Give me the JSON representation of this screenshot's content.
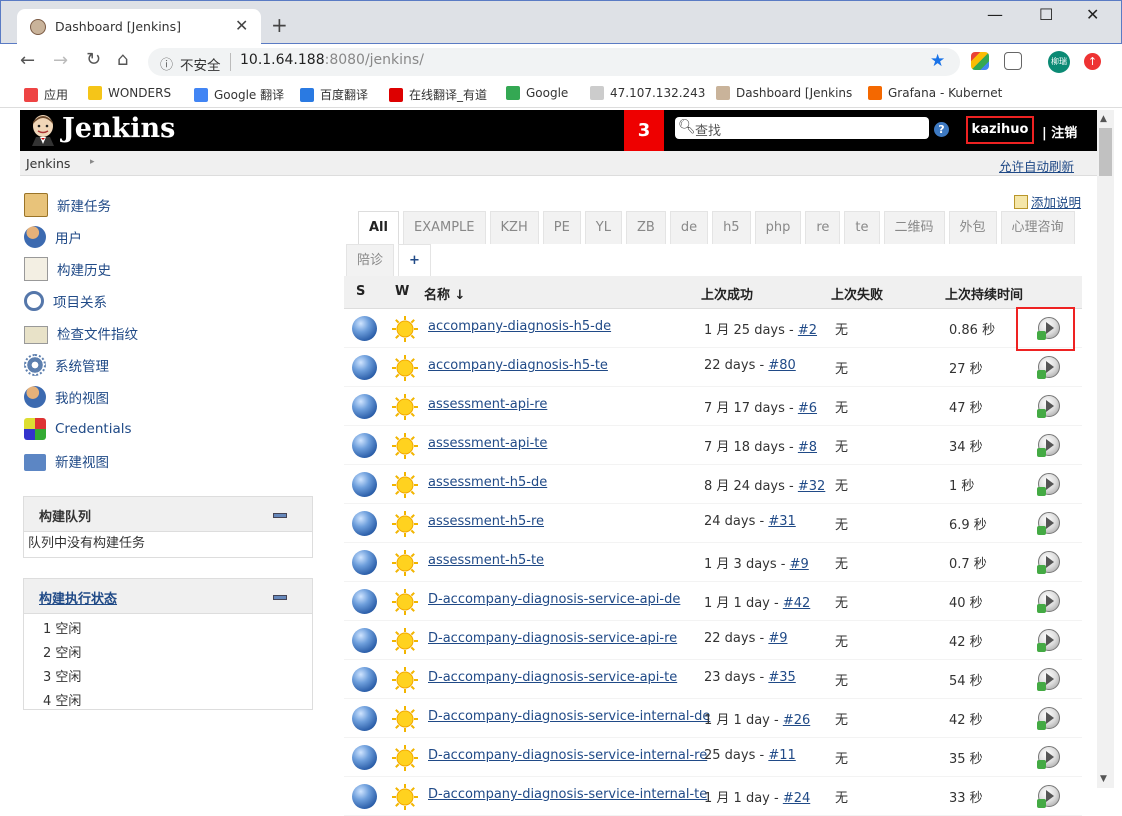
{
  "browser": {
    "tab_title": "Dashboard [Jenkins]",
    "close_glyph": "✕",
    "newtab_glyph": "+",
    "address_info": "ⓘ",
    "address_insecure": "不安全",
    "address_host": "10.1.64.188",
    "address_path": ":8080/jenkins/",
    "ext_label": "柳瑞"
  },
  "bookmarks": [
    {
      "label": "应用",
      "icon_color": "#e44"
    },
    {
      "label": "WONDERS",
      "icon_color": "#f5c518"
    },
    {
      "label": "Google 翻译",
      "icon_color": "#4285f4"
    },
    {
      "label": "百度翻译",
      "icon_color": "#2a7ae2"
    },
    {
      "label": "在线翻译_有道",
      "icon_color": "#d00"
    },
    {
      "label": "Google",
      "icon_color": "#34a853"
    },
    {
      "label": "47.107.132.243",
      "icon_color": "#ccc"
    },
    {
      "label": "Dashboard [Jenkins",
      "icon_color": "#c9b39a"
    },
    {
      "label": "Grafana - Kubernet",
      "icon_color": "#f46800"
    }
  ],
  "header": {
    "title": "Jenkins",
    "badge_count": "3",
    "search_placeholder": "查找",
    "help": "?",
    "username": "kazihuo",
    "logout": "| 注销"
  },
  "breadcrumb": {
    "root": "Jenkins",
    "arrow": "▸",
    "auto_refresh": "允许自动刷新"
  },
  "sidebar": {
    "items": [
      {
        "label": "新建任务",
        "icon": "new-job-icon"
      },
      {
        "label": "用户",
        "icon": "users-icon"
      },
      {
        "label": "构建历史",
        "icon": "build-history-icon"
      },
      {
        "label": "项目关系",
        "icon": "search-icon"
      },
      {
        "label": "检查文件指纹",
        "icon": "fingerprint-icon"
      },
      {
        "label": "系统管理",
        "icon": "gear-icon"
      },
      {
        "label": "我的视图",
        "icon": "my-views-icon"
      },
      {
        "label": "Credentials",
        "icon": "credentials-icon"
      },
      {
        "label": "新建视图",
        "icon": "folder-icon"
      }
    ],
    "build_queue": {
      "title": "构建队列",
      "empty_text": "队列中没有构建任务"
    },
    "executors": {
      "title": "构建执行状态",
      "rows": [
        "1  空闲",
        "2  空闲",
        "3  空闲",
        "4  空闲"
      ]
    }
  },
  "main": {
    "add_description": "添加说明",
    "view_tabs_row1": [
      "All",
      "EXAMPLE",
      "KZH",
      "PE",
      "YL",
      "ZB",
      "de",
      "h5",
      "php",
      "re",
      "te",
      "二维码",
      "外包",
      "心理咨询"
    ],
    "view_tabs_row2": [
      "陪诊",
      "+"
    ],
    "columns": {
      "s": "S",
      "w": "W",
      "name": "名称 ↓",
      "last_success": "上次成功",
      "last_failure": "上次失败",
      "last_duration": "上次持续时间"
    },
    "jobs": [
      {
        "name": "accompany-diagnosis-h5-de",
        "success_text": "1 月 25 days - ",
        "build": "#2",
        "failure": "无",
        "duration": "0.86 秒"
      },
      {
        "name": "accompany-diagnosis-h5-te",
        "success_text": "22 days - ",
        "build": "#80",
        "failure": "无",
        "duration": "27 秒"
      },
      {
        "name": "assessment-api-re",
        "success_text": "7 月 17 days - ",
        "build": "#6",
        "failure": "无",
        "duration": "47 秒"
      },
      {
        "name": "assessment-api-te",
        "success_text": "7 月 18 days - ",
        "build": "#8",
        "failure": "无",
        "duration": "34 秒"
      },
      {
        "name": "assessment-h5-de",
        "success_text": "8 月 24 days - ",
        "build": "#32",
        "failure": "无",
        "duration": "1 秒"
      },
      {
        "name": "assessment-h5-re",
        "success_text": "24 days - ",
        "build": "#31",
        "failure": "无",
        "duration": "6.9 秒"
      },
      {
        "name": "assessment-h5-te",
        "success_text": "1 月 3 days - ",
        "build": "#9",
        "failure": "无",
        "duration": "0.7 秒"
      },
      {
        "name": "D-accompany-diagnosis-service-api-de",
        "success_text": "1 月 1 day - ",
        "build": "#42",
        "failure": "无",
        "duration": "40 秒"
      },
      {
        "name": "D-accompany-diagnosis-service-api-re",
        "success_text": "22 days - ",
        "build": "#9",
        "failure": "无",
        "duration": "42 秒"
      },
      {
        "name": "D-accompany-diagnosis-service-api-te",
        "success_text": "23 days - ",
        "build": "#35",
        "failure": "无",
        "duration": "54 秒"
      },
      {
        "name": "D-accompany-diagnosis-service-internal-de",
        "success_text": "1 月 1 day - ",
        "build": "#26",
        "failure": "无",
        "duration": "42 秒"
      },
      {
        "name": "D-accompany-diagnosis-service-internal-re",
        "success_text": "25 days - ",
        "build": "#11",
        "failure": "无",
        "duration": "35 秒"
      },
      {
        "name": "D-accompany-diagnosis-service-internal-te",
        "success_text": "1 月 1 day - ",
        "build": "#24",
        "failure": "无",
        "duration": "33 秒"
      }
    ]
  },
  "colors": {
    "link": "#204a87",
    "header_bg": "#000000",
    "badge": "#ee0000",
    "highlight": "#ee2222"
  }
}
